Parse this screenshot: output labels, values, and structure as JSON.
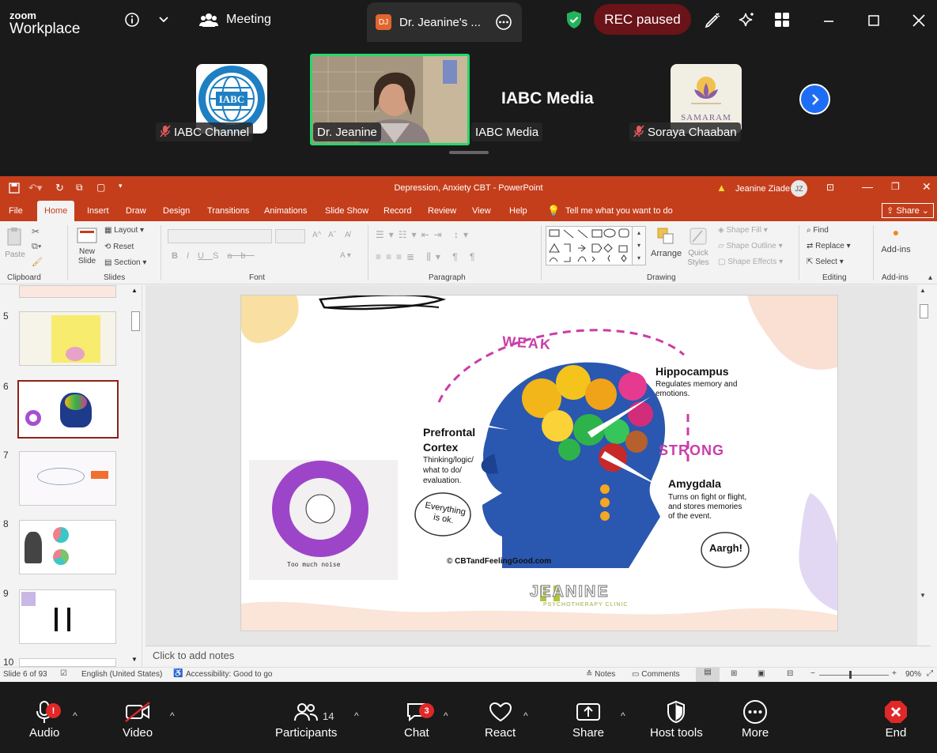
{
  "app": {
    "brand_line1": "zoom",
    "brand_line2": "Workplace"
  },
  "topbar": {
    "meeting_label": "Meeting",
    "share_tab_initials": "DJ",
    "share_tab_label": "Dr. Jeanine's ...",
    "rec_label": "REC paused"
  },
  "gallery": {
    "participants": [
      {
        "name": "IABC Channel",
        "muted": true
      },
      {
        "name": "Dr. Jeanine",
        "muted": false
      },
      {
        "name": "IABC Media",
        "muted": false
      },
      {
        "name": "Soraya Chaaban",
        "muted": true
      }
    ],
    "iabc_tile_text": "IABC Media",
    "samaram_label": "SAMARAM"
  },
  "ppt": {
    "title": "Depression, Anxiety CBT  -  PowerPoint",
    "user": "Jeanine Ziade",
    "user_initials": "JZ",
    "tabs": [
      "File",
      "Home",
      "Insert",
      "Draw",
      "Design",
      "Transitions",
      "Animations",
      "Slide Show",
      "Record",
      "Review",
      "View",
      "Help"
    ],
    "tell_me": "Tell me what you want to do",
    "share": "Share",
    "ribbon": {
      "clipboard": "Clipboard",
      "paste": "Paste",
      "new_slide": "New Slide",
      "layout": "Layout",
      "reset": "Reset",
      "section": "Section",
      "slides": "Slides",
      "font": "Font",
      "paragraph": "Paragraph",
      "arrange": "Arrange",
      "quick_styles": "Quick Styles",
      "shape_fill": "Shape Fill",
      "shape_outline": "Shape Outline",
      "shape_effects": "Shape Effects",
      "drawing": "Drawing",
      "find": "Find",
      "replace": "Replace",
      "select": "Select",
      "editing": "Editing",
      "addins": "Add-ins",
      "addins_group": "Add-ins"
    },
    "thumb_numbers": [
      "5",
      "6",
      "7",
      "8",
      "9",
      "10"
    ],
    "slide": {
      "weak": "WEAK",
      "strong": "STRONG",
      "hippocampus": "Hippocampus",
      "hippocampus_desc": "Regulates memory and emotions.",
      "prefrontal": "Prefrontal Cortex",
      "prefrontal_desc": "Thinking/logic/ what to do/ evaluation.",
      "amygdala": "Amygdala",
      "amygdala_desc": "Turns on fight or flight, and stores memories of the event.",
      "bubble1": "Everything is ok.",
      "bubble2": "Aargh!",
      "credit": "© CBTandFeelingGood.com",
      "logo": "JEANINE",
      "logo_sub": "PSYCHOTHERAPY CLINIC",
      "sketch_caption": "Too much noise"
    },
    "notes": "Click to add notes",
    "status": {
      "slide": "Slide 6 of 93",
      "lang": "English (United States)",
      "access": "Accessibility: Good to go",
      "notes": "Notes",
      "comments": "Comments",
      "zoom": "90%"
    }
  },
  "toolbar": {
    "audio": "Audio",
    "video": "Video",
    "participants": "Participants",
    "participants_count": "14",
    "chat": "Chat",
    "chat_badge": "3",
    "react": "React",
    "share": "Share",
    "host_tools": "Host tools",
    "more": "More",
    "end": "End",
    "audio_badge": "!"
  }
}
